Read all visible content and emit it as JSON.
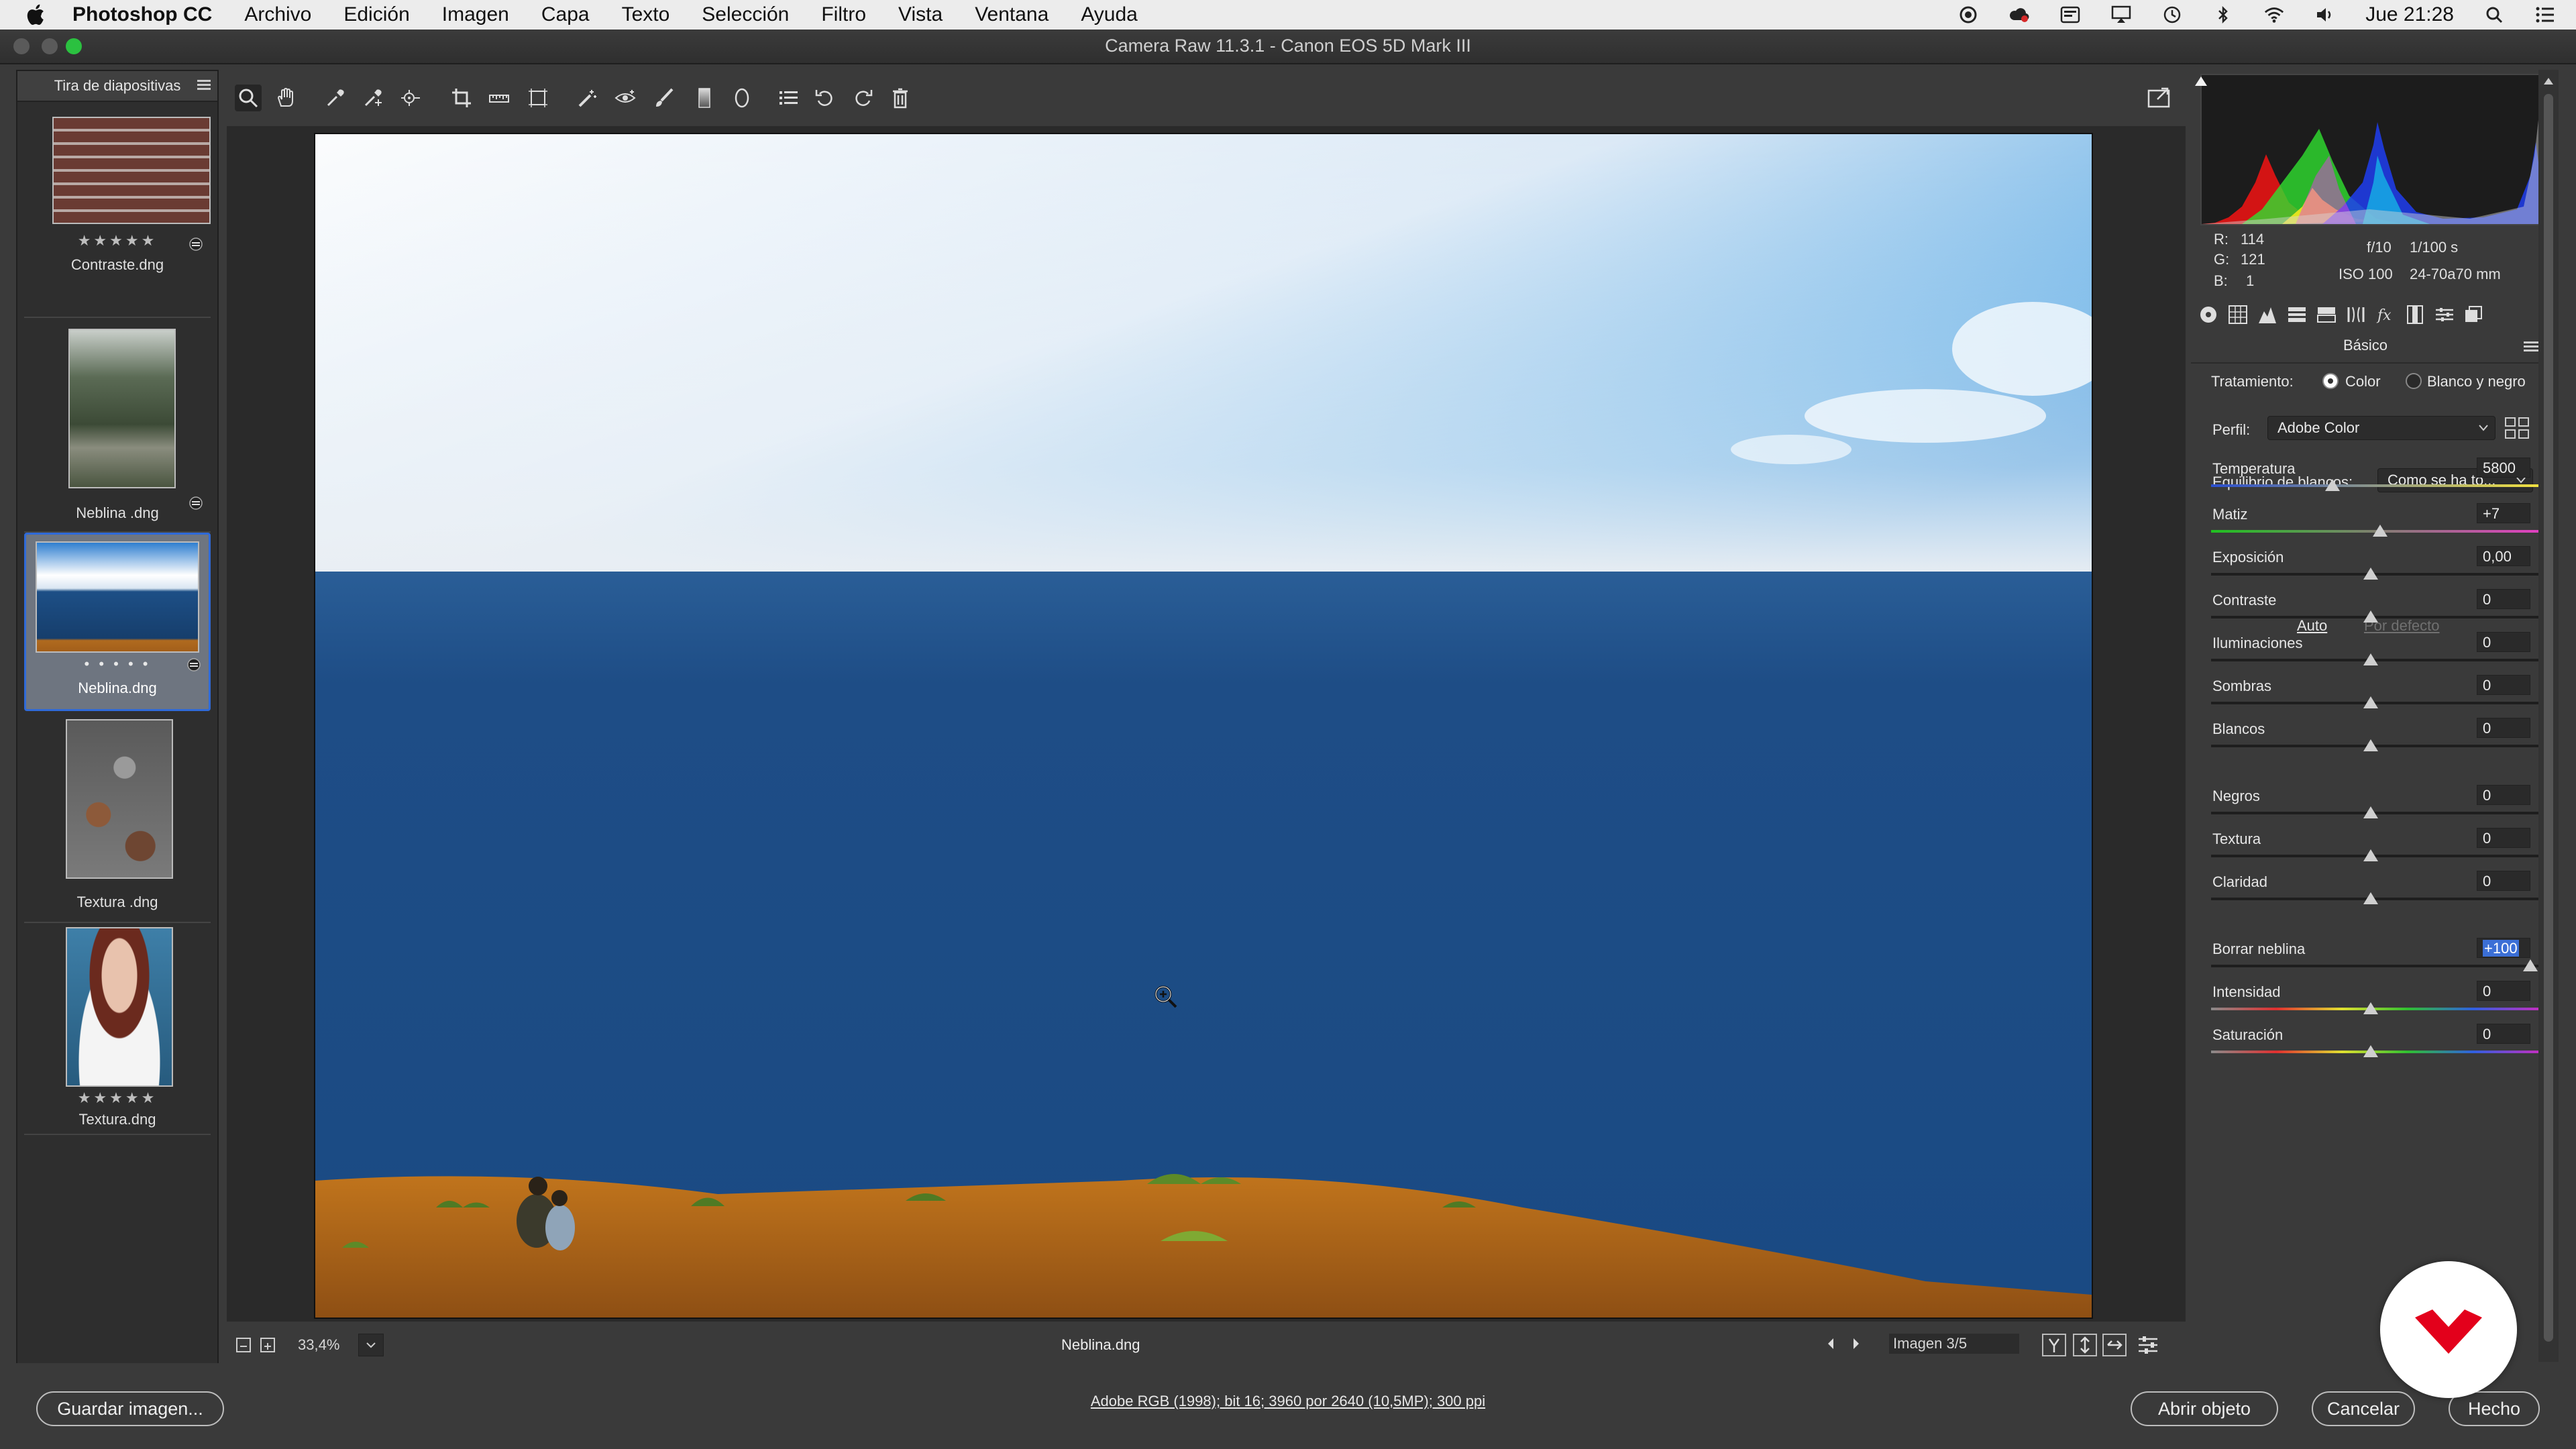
{
  "menubar": {
    "items": [
      "Photoshop CC",
      "Archivo",
      "Edición",
      "Imagen",
      "Capa",
      "Texto",
      "Selección",
      "Filtro",
      "Vista",
      "Ventana",
      "Ayuda"
    ],
    "clock": "Jue 21:28"
  },
  "window": {
    "title": "Camera Raw 11.3.1 -  Canon EOS 5D Mark III"
  },
  "filmstrip": {
    "title": "Tira de diapositivas",
    "items": [
      {
        "name": "Contraste.dng",
        "stars": "★★★★★"
      },
      {
        "name": "Neblina .dng",
        "stars": ""
      },
      {
        "name": "Neblina.dng",
        "stars": "• • • • •"
      },
      {
        "name": "Textura .dng",
        "stars": ""
      },
      {
        "name": "Textura.dng",
        "stars": "★★★★★"
      }
    ]
  },
  "previewbar": {
    "zoom": "33,4%",
    "filename": "Neblina.dng",
    "image_counter": "Imagen 3/5"
  },
  "info": {
    "r_label": "R:",
    "r_value": "114",
    "g_label": "G:",
    "g_value": "121",
    "b_label": "B:",
    "b_value": "1",
    "aperture": "f/10",
    "shutter": "1/100 s",
    "iso": "ISO 100",
    "lens": "24-70a70 mm"
  },
  "panel": {
    "title": "Básico",
    "treatment_label": "Tratamiento:",
    "treatment_color": "Color",
    "treatment_bw": "Blanco y negro",
    "profile_label": "Perfil:",
    "profile_value": "Adobe Color",
    "wb_label": "Equilibrio de blancos:",
    "wb_value": "Como se ha to...",
    "auto": "Auto",
    "default": "Por defecto",
    "sliders": [
      {
        "label": "Temperatura",
        "value": "5800",
        "pos": 0.38
      },
      {
        "label": "Matiz",
        "value": "+7",
        "pos": 0.53
      },
      {
        "label": "Exposición",
        "value": "0,00",
        "pos": 0.5
      },
      {
        "label": "Contraste",
        "value": "0",
        "pos": 0.5
      },
      {
        "label": "Iluminaciones",
        "value": "0",
        "pos": 0.5
      },
      {
        "label": "Sombras",
        "value": "0",
        "pos": 0.5
      },
      {
        "label": "Blancos",
        "value": "0",
        "pos": 0.5
      },
      {
        "label": "Negros",
        "value": "0",
        "pos": 0.5
      },
      {
        "label": "Textura",
        "value": "0",
        "pos": 0.5
      },
      {
        "label": "Claridad",
        "value": "0",
        "pos": 0.5
      },
      {
        "label": "Borrar neblina",
        "value": "+100",
        "pos": 1.0
      },
      {
        "label": "Intensidad",
        "value": "0",
        "pos": 0.5
      },
      {
        "label": "Saturación",
        "value": "0",
        "pos": 0.5
      }
    ]
  },
  "footer": {
    "save": "Guardar imagen...",
    "file_info": "Adobe RGB (1998); bit 16; 3960 por 2640 (10,5MP); 300 ppi",
    "open": "Abrir objeto",
    "cancel": "Cancelar",
    "done": "Hecho"
  },
  "colors": {
    "accent": "#2f6ad8",
    "brand_badge": "#e3001b"
  }
}
